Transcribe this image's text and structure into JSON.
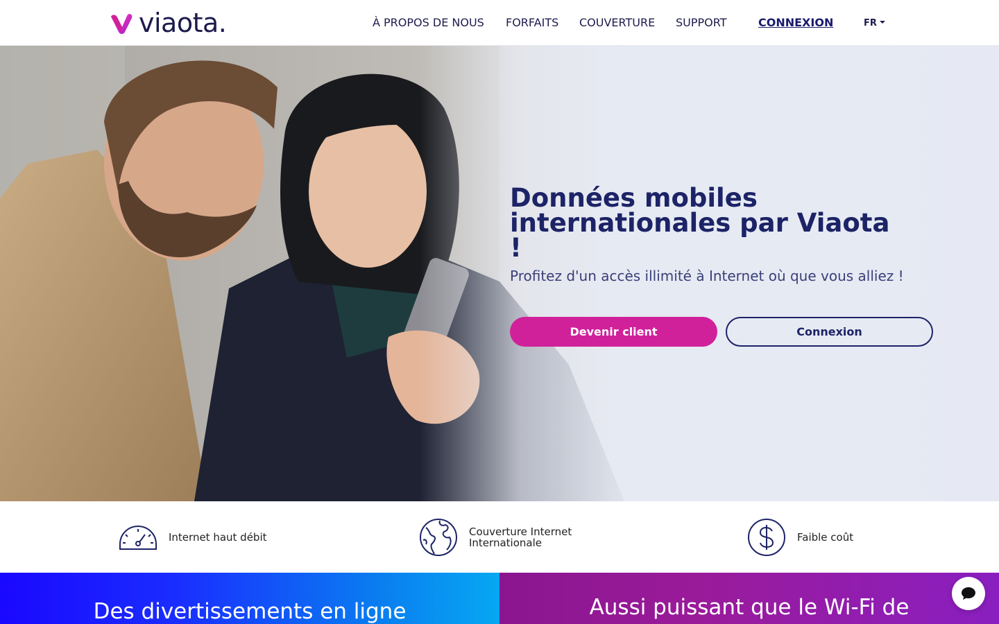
{
  "brand": {
    "name": "viaota.",
    "colors": {
      "primary": "#1c2366",
      "accent": "#d0219a"
    }
  },
  "nav": {
    "about": "À PROPOS DE NOUS",
    "plans": "FORFAITS",
    "coverage": "COUVERTURE",
    "support": "SUPPORT",
    "login": "CONNEXION",
    "language": "FR"
  },
  "hero": {
    "title": "Données mobiles internationales par Viaota !",
    "subtitle": "Profitez d'un accès illimité à Internet où que vous alliez !",
    "primary_button": "Devenir client",
    "secondary_button": "Connexion"
  },
  "features": [
    {
      "icon": "speedometer-icon",
      "label": "Internet haut débit"
    },
    {
      "icon": "globe-icon",
      "label": "Couverture Internet Internationale"
    },
    {
      "icon": "dollar-icon",
      "label": "Faible coût"
    }
  ],
  "banners": {
    "left": "Des divertissements en ligne",
    "right": "Aussi puissant que le Wi-Fi de"
  },
  "chat": {
    "icon": "chat-bubble-icon"
  }
}
